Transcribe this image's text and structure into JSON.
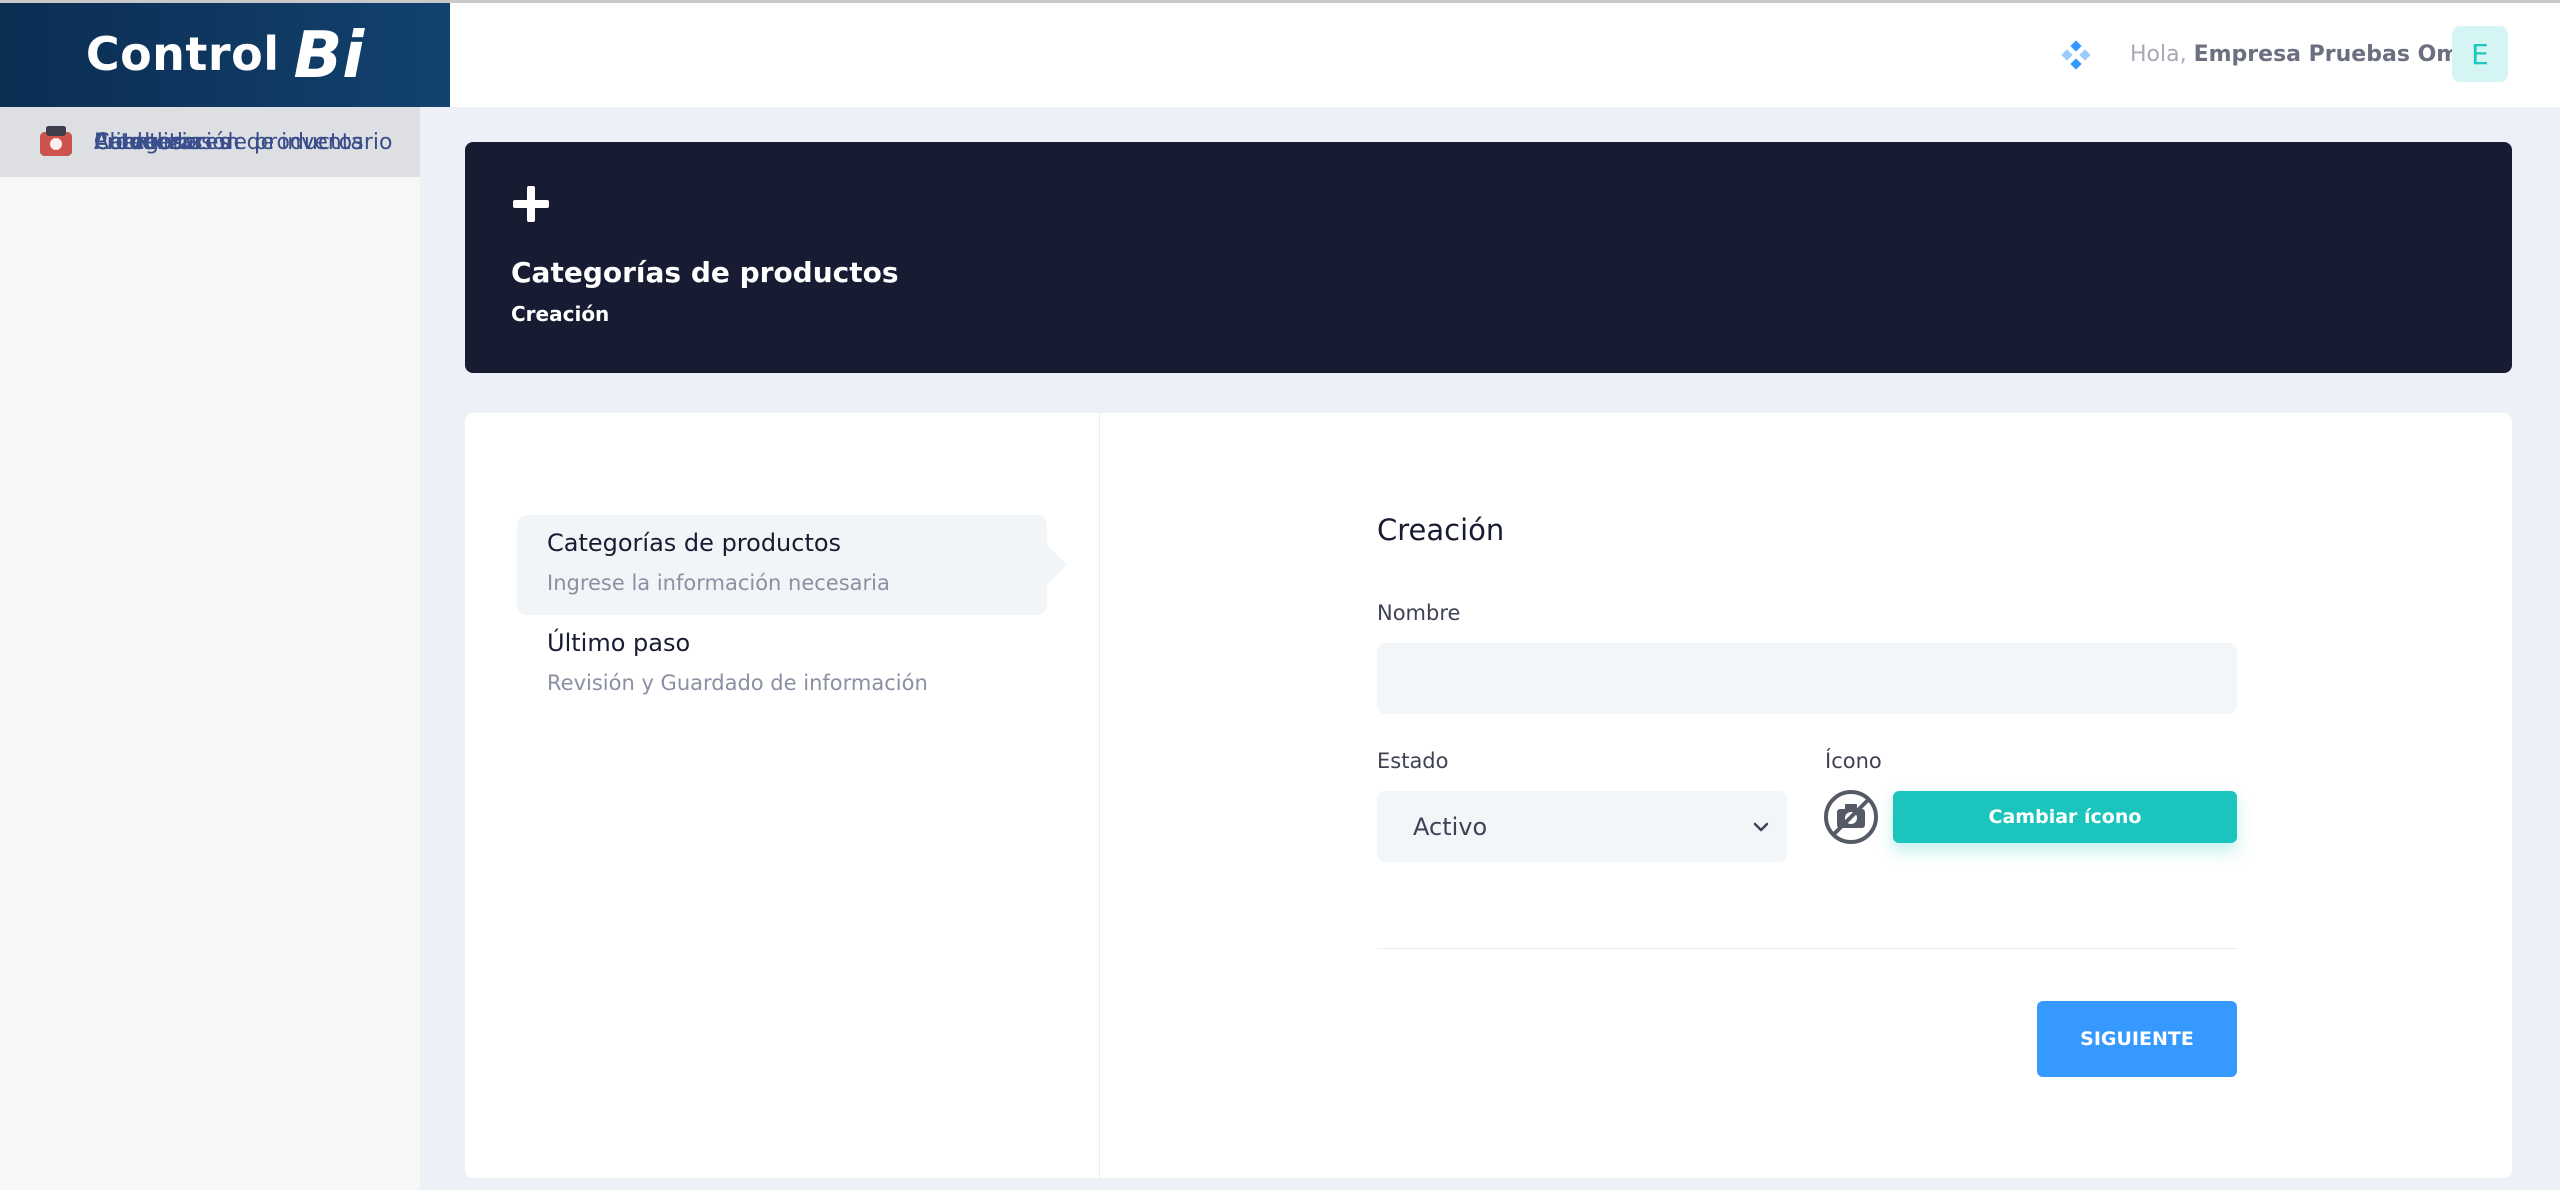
{
  "brand": {
    "logo_text": "Control",
    "logo_mark": "Bi"
  },
  "header": {
    "app_icon": "diamond-grid-icon",
    "greeting_prefix": "Hola,",
    "user_name": "Empresa Pruebas Omar",
    "avatar_letter": "E"
  },
  "sidebar": {
    "items": [
      {
        "label": "Estaciones de trabajo",
        "icon": "workstation-icon"
      },
      {
        "label": "Descuentos",
        "icon": "discount-icon"
      },
      {
        "label": "Citas",
        "icon": "calendar-icon"
      },
      {
        "label": "Tiempos de comida",
        "icon": "meal-time-icon"
      },
      {
        "label": "Categorías de ingredientes",
        "icon": "ingredient-category-icon"
      },
      {
        "label": "Unidades de medida",
        "icon": "measure-unit-icon"
      },
      {
        "label": "Ingredientes",
        "icon": "ingredients-icon"
      },
      {
        "label": "Categorías de recetas",
        "icon": "recipe-category-icon"
      },
      {
        "label": "Recetas",
        "icon": "recipes-icon"
      },
      {
        "label": "Categorias de productos",
        "icon": "product-category-icon",
        "active": true
      },
      {
        "label": "Productos",
        "icon": "products-icon"
      },
      {
        "label": "Combos",
        "icon": "combos-icon"
      },
      {
        "label": "Proveedores",
        "icon": "suppliers-icon"
      },
      {
        "label": "Actualización de inventario",
        "icon": "inventory-icon"
      },
      {
        "label": "Clientes",
        "icon": "clients-icon"
      }
    ]
  },
  "banner": {
    "icon": "plus-icon",
    "title": "Categorías de productos",
    "subtitle": "Creación"
  },
  "stepper": {
    "steps": [
      {
        "title": "Categorías de productos",
        "desc": "Ingrese la información necesaria"
      },
      {
        "title": "Último paso",
        "desc": "Revisión y Guardado de información"
      }
    ]
  },
  "form": {
    "title": "Creación",
    "name_label": "Nombre",
    "name_value": "",
    "status_label": "Estado",
    "status_value": "Activo",
    "icon_label": "Ícono",
    "change_icon_label": "Cambiar ícono",
    "next_label": "SIGUIENTE"
  },
  "colors": {
    "banner_bg": "#181c32",
    "teal_button": "#1bc5bd",
    "primary_button": "#3699ff",
    "sidebar_label": "#3a4e8c"
  }
}
